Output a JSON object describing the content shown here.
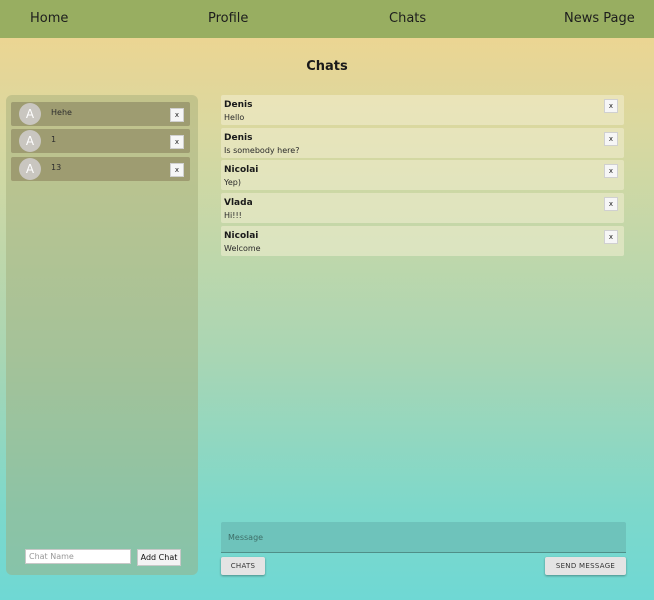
{
  "nav": {
    "items": [
      {
        "label": "Home"
      },
      {
        "label": "Profile"
      },
      {
        "label": "Chats"
      },
      {
        "label": "News Page"
      }
    ]
  },
  "page": {
    "title": "Chats"
  },
  "sidebar": {
    "chats": [
      {
        "avatar": "A",
        "name": "Hehe",
        "delete_label": "x"
      },
      {
        "avatar": "A",
        "name": "1",
        "delete_label": "x"
      },
      {
        "avatar": "A",
        "name": "13",
        "delete_label": "x"
      }
    ],
    "chat_name_placeholder": "Chat Name",
    "add_chat_label": "Add Chat"
  },
  "messages": [
    {
      "author": "Denis",
      "text": "Hello",
      "delete_label": "x"
    },
    {
      "author": "Denis",
      "text": "Is somebody here?",
      "delete_label": "x"
    },
    {
      "author": "Nicolai",
      "text": "Yep)",
      "delete_label": "x"
    },
    {
      "author": "Vlada",
      "text": "Hi!!!",
      "delete_label": "x"
    },
    {
      "author": "Nicolai",
      "text": "Welcome",
      "delete_label": "x"
    }
  ],
  "composer": {
    "placeholder": "Message",
    "chats_button": "CHATS",
    "send_button": "SEND MESSAGE"
  },
  "colors": {
    "navbar": "#98ae61",
    "chat_item": "#9e9c71",
    "message_input": "#6ec3bb"
  }
}
